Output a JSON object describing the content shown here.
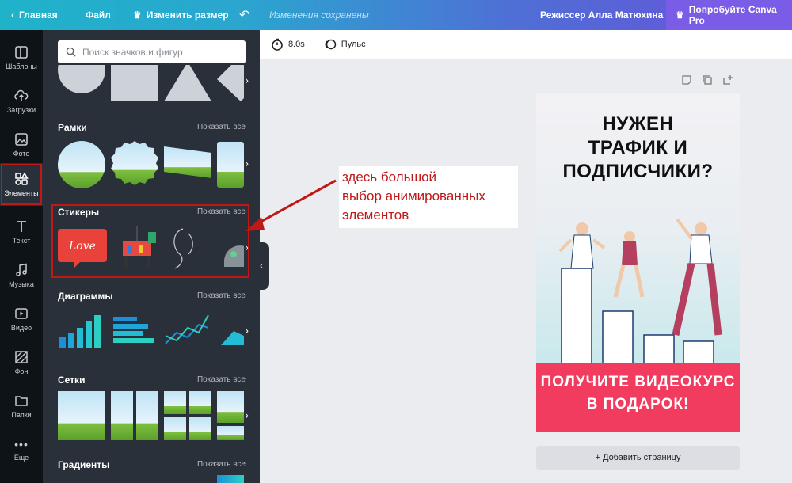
{
  "topbar": {
    "home": "Главная",
    "file": "Файл",
    "resize": "Изменить размер",
    "saved": "Изменения сохранены",
    "user": "Режиссер Алла Матюхина",
    "pro": "Попробуйте Canva Pro"
  },
  "rail": {
    "templates": "Шаблоны",
    "uploads": "Загрузки",
    "photos": "Фото",
    "elements": "Элементы",
    "text": "Текст",
    "music": "Музыка",
    "video": "Видео",
    "background": "Фон",
    "folders": "Папки",
    "more": "Еще"
  },
  "panel": {
    "search_placeholder": "Поиск значков и фигур",
    "show_all": "Показать все",
    "sections": {
      "frames": "Рамки",
      "stickers": "Стикеры",
      "charts": "Диаграммы",
      "grids": "Сетки",
      "gradients": "Градиенты"
    },
    "love_sticker": "Love"
  },
  "toolbar": {
    "duration": "8.0s",
    "animation": "Пульс"
  },
  "design": {
    "headline": [
      "НУЖЕН",
      "ТРАФИК И",
      "ПОДПИСЧИКИ?"
    ],
    "footer": [
      "ПОЛУЧИТЕ ВИДЕОКУРС",
      "В ПОДАРОК!"
    ]
  },
  "add_page": "+ Добавить страницу",
  "annotation": [
    "здесь большой",
    "выбор анимированных",
    "элементов"
  ],
  "colors": {
    "accent_red": "#c01717",
    "footer_pink": "#f23c5f",
    "panel_bg": "#293039",
    "rail_bg": "#0e1318"
  }
}
